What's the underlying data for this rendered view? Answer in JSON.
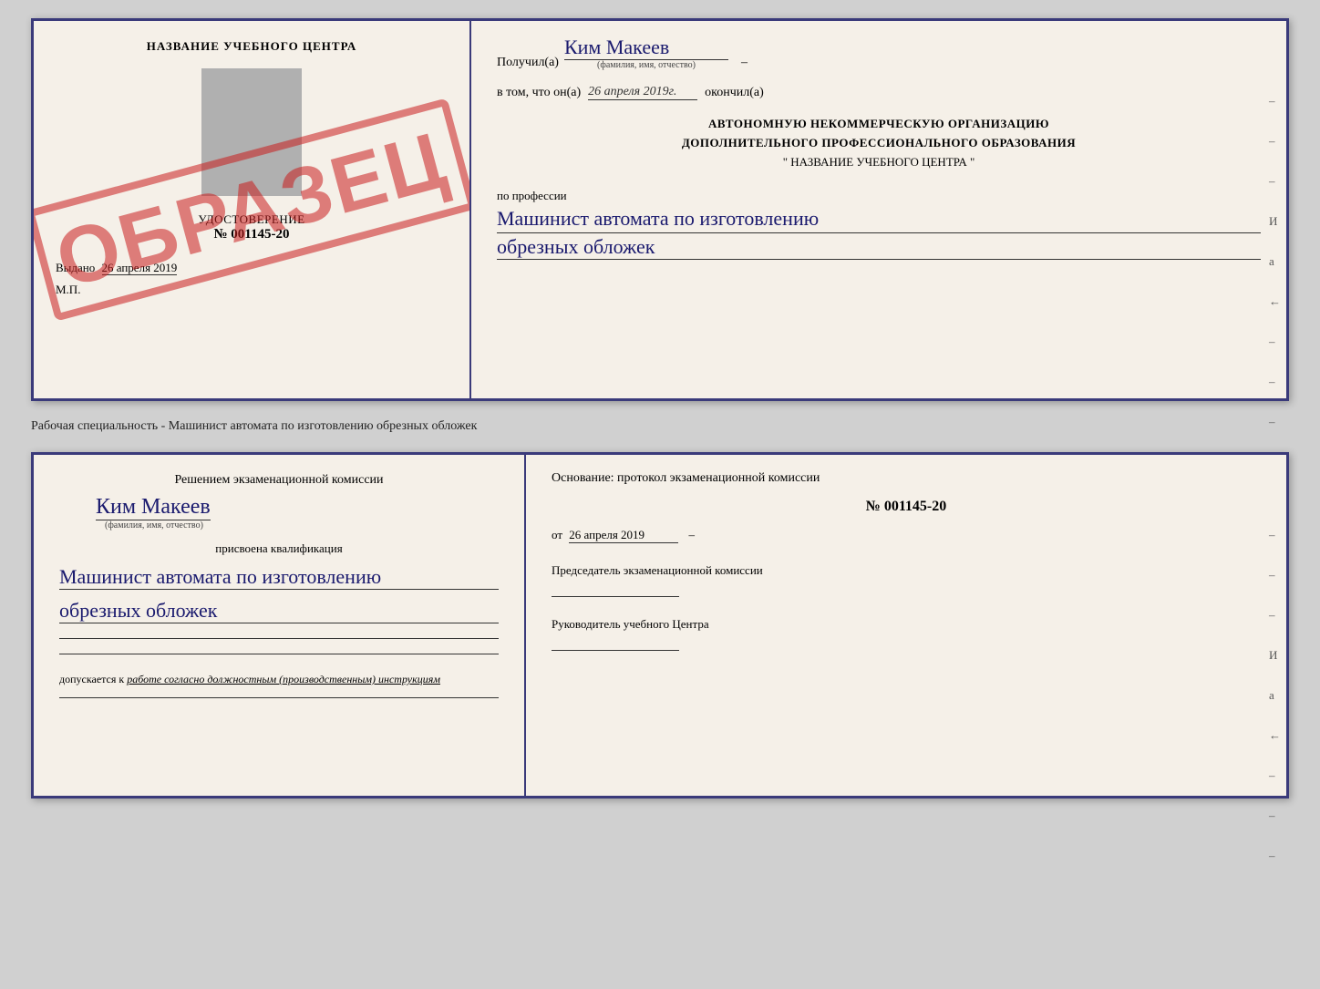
{
  "topDoc": {
    "left": {
      "title": "НАЗВАНИЕ УЧЕБНОГО ЦЕНТРА",
      "stamp": "ОБРАЗЕЦ",
      "udostTitle": "УДОСТОВЕРЕНИЕ",
      "udostNumber": "№ 001145-20",
      "issuedLabel": "Выдано",
      "issuedDate": "26 апреля 2019",
      "mpLabel": "М.П."
    },
    "right": {
      "receivedLabel": "Получил(а)",
      "receivedName": "Ким Макеев",
      "fioSub": "(фамилия, имя, отчество)",
      "vtomLabel": "в том, что он(а)",
      "date": "26 апреля 2019г.",
      "okonchilLabel": "окончил(а)",
      "orgLine1": "АВТОНОМНУЮ НЕКОММЕРЧЕСКУЮ ОРГАНИЗАЦИЮ",
      "orgLine2": "ДОПОЛНИТЕЛЬНОГО ПРОФЕССИОНАЛЬНОГО ОБРАЗОВАНИЯ",
      "orgLine3": "\" НАЗВАНИЕ УЧЕБНОГО ЦЕНТРА \"",
      "professionLabel": "по профессии",
      "profession1": "Машинист автомата по изготовлению",
      "profession2": "обрезных обложек",
      "sideMarks": [
        "-",
        "-",
        "-",
        "И",
        "а",
        "←",
        "-",
        "-",
        "-"
      ]
    }
  },
  "middleLabel": "Рабочая специальность - Машинист автомата по изготовлению обрезных обложек",
  "bottomDoc": {
    "left": {
      "decisionLabel": "Решением экзаменационной комиссии",
      "personName": "Ким Макеев",
      "fioSub": "(фамилия, имя, отчество)",
      "assignedLabel": "присвоена квалификация",
      "qualification1": "Машинист автомата по изготовлению",
      "qualification2": "обрезных обложек",
      "допускаетсяLabel": "допускается к",
      "допускаетсяValue": "работе согласно должностным (производственным) инструкциям"
    },
    "right": {
      "osnovLabel": "Основание: протокол экзаменационной комиссии",
      "protocolNumber": "№ 001145-20",
      "protocolDatePrefix": "от",
      "protocolDate": "26 апреля 2019",
      "predsedLabel": "Председатель экзаменационной комиссии",
      "rukovodLabel": "Руководитель учебного Центра",
      "sideMarks": [
        "-",
        "-",
        "-",
        "И",
        "а",
        "←",
        "-",
        "-",
        "-"
      ]
    }
  }
}
